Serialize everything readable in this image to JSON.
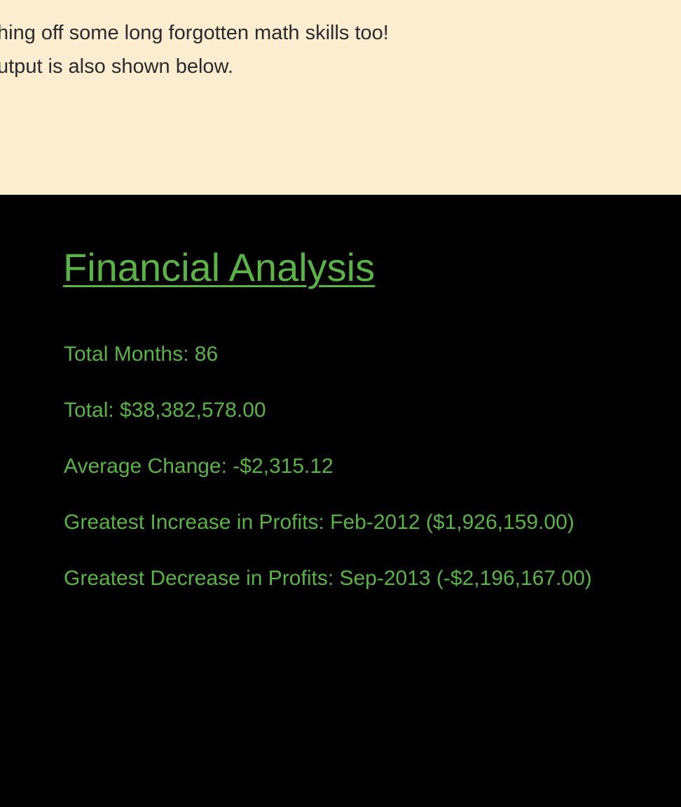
{
  "intro": {
    "line1": "hing off some long forgotten math skills too!",
    "line2": "utput is also shown below."
  },
  "analysis": {
    "title": "Financial Analysis",
    "total_months": "Total Months: 86",
    "total": "Total: $38,382,578.00",
    "average_change": "Average Change: -$2,315.12",
    "greatest_increase": "Greatest Increase in Profits: Feb-2012 ($1,926,159.00)",
    "greatest_decrease": "Greatest Decrease in Profits: Sep-2013 (-$2,196,167.00)"
  },
  "colors": {
    "top_background": "#fcecd0",
    "terminal_background": "#000000",
    "accent_green": "#5bb347",
    "body_text": "#2b2b2b"
  }
}
